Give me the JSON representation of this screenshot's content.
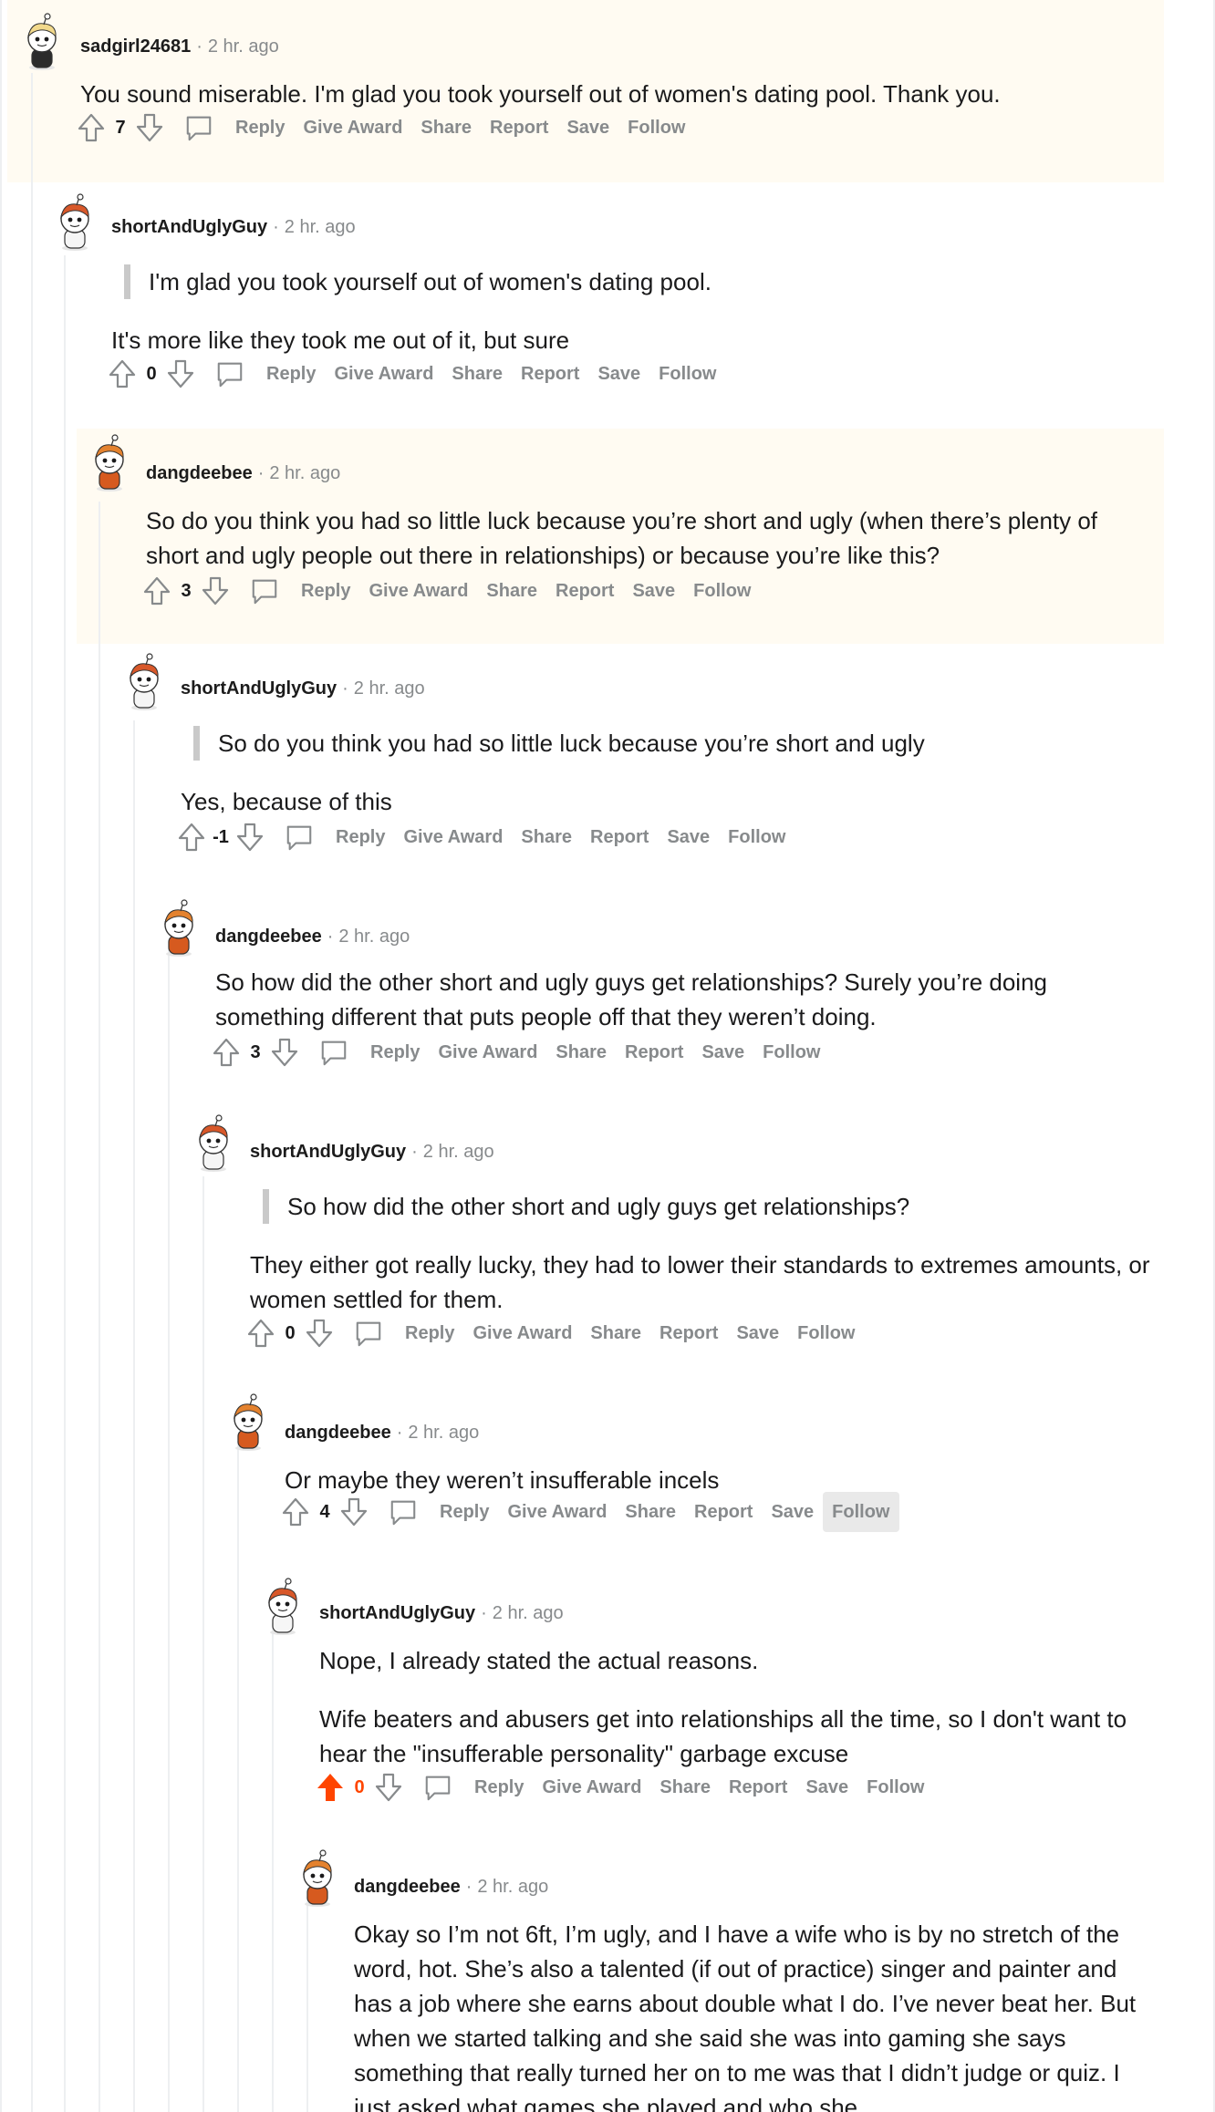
{
  "comments": [
    {
      "user": "sadgirl24681",
      "time": "2 hr. ago",
      "quote": "",
      "paragraphs": [
        "You sound miserable. I'm glad you took yourself out of women's dating pool. Thank you."
      ],
      "score": "7",
      "upvoted": false
    },
    {
      "user": "shortAndUglyGuy",
      "time": "2 hr. ago",
      "quote": "I'm glad you took yourself out of women's dating pool.",
      "paragraphs": [
        "It's more like they took me out of it, but sure"
      ],
      "score": "0",
      "upvoted": false
    },
    {
      "user": "dangdeebee",
      "time": "2 hr. ago",
      "quote": "",
      "paragraphs": [
        "So do you think you had so little luck because you’re short and ugly (when there’s plenty of short and ugly people out there in relationships) or because you’re like this?"
      ],
      "score": "3",
      "upvoted": false
    },
    {
      "user": "shortAndUglyGuy",
      "time": "2 hr. ago",
      "quote": "So do you think you had so little luck because you’re short and ugly",
      "paragraphs": [
        "Yes, because of this"
      ],
      "score": "-1",
      "upvoted": false
    },
    {
      "user": "dangdeebee",
      "time": "2 hr. ago",
      "quote": "",
      "paragraphs": [
        "So how did the other short and ugly guys get relationships? Surely you’re doing something different that puts people off that they weren’t doing."
      ],
      "score": "3",
      "upvoted": false
    },
    {
      "user": "shortAndUglyGuy",
      "time": "2 hr. ago",
      "quote": "So how did the other short and ugly guys get relationships?",
      "paragraphs": [
        "They either got really lucky, they had to lower their standards to extremes amounts, or women settled for them."
      ],
      "score": "0",
      "upvoted": false
    },
    {
      "user": "dangdeebee",
      "time": "2 hr. ago",
      "quote": "",
      "paragraphs": [
        "Or maybe they weren’t insufferable incels"
      ],
      "score": "4",
      "upvoted": false
    },
    {
      "user": "shortAndUglyGuy",
      "time": "2 hr. ago",
      "quote": "",
      "paragraphs": [
        "Nope, I already stated the actual reasons.",
        "Wife beaters and abusers get into relationships all the time, so I don't want to hear the \"insufferable personality\" garbage excuse"
      ],
      "score": "0",
      "upvoted": true
    },
    {
      "user": "dangdeebee",
      "time": "2 hr. ago",
      "quote": "",
      "paragraphs": [
        "Okay so I’m not 6ft, I’m ugly, and I have a wife who is by no stretch of the word, hot. She’s also a talented (if out of practice) singer and painter and has a job where she earns about double what I do. I’ve never beat her. But when we started talking and she said she was into gaming she says something that really turned her on to me was that I didn’t judge or quiz. I just asked what games she played and who she"
      ],
      "score": "",
      "upvoted": false
    }
  ],
  "actions": {
    "reply": "Reply",
    "give_award": "Give Award",
    "share": "Share",
    "report": "Report",
    "save": "Save",
    "follow": "Follow"
  },
  "colors": {
    "highlight_bg": "#fffbf2",
    "upvote_active": "#ff4500",
    "meta_gray": "#878a8c",
    "thread_line": "#edeff1"
  },
  "icons": [
    "upvote-icon",
    "downvote-icon",
    "comment-bubble-icon",
    "snoo-avatar-icon"
  ]
}
